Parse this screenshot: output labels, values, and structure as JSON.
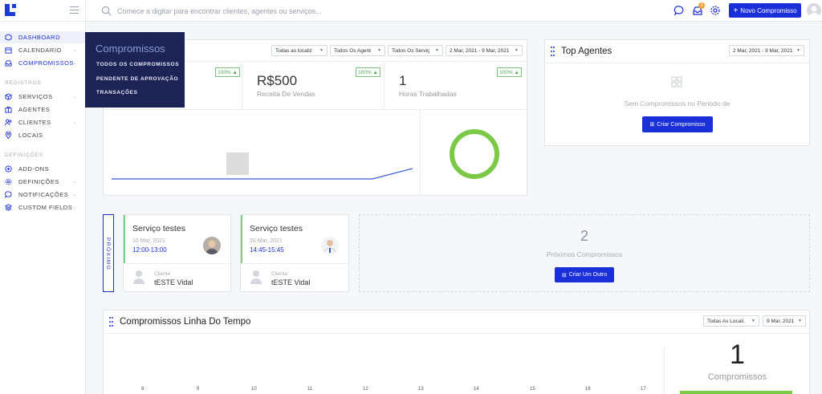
{
  "header": {
    "search_placeholder": "Comece a digitar para encontrar clientes, agentes ou serviços...",
    "notification_count": "1",
    "new_button_label": "Novo Compromisso",
    "new_button_icon": "plus-icon"
  },
  "sidebar": {
    "items": [
      {
        "label": "DASHBOARD",
        "icon": "dashboard-icon",
        "active": true
      },
      {
        "label": "CALENDARIO",
        "icon": "calendar-icon",
        "has_chevron": true
      },
      {
        "label": "COMPROMISSOS",
        "icon": "inbox-icon",
        "has_chevron": true
      }
    ],
    "section_registros": "REGISTROS",
    "registros": [
      {
        "label": "SERVIÇOS",
        "icon": "box-icon",
        "has_chevron": true
      },
      {
        "label": "AGENTES",
        "icon": "briefcase-icon"
      },
      {
        "label": "CLIENTES",
        "icon": "users-icon",
        "has_chevron": true
      },
      {
        "label": "LOCAIS",
        "icon": "map-pin-icon"
      }
    ],
    "section_definicoes": "DEFINIÇÕES",
    "definicoes": [
      {
        "label": "ADD-ONS",
        "icon": "plus-circle-icon"
      },
      {
        "label": "DEFINIÇÕES",
        "icon": "gear-icon",
        "has_chevron": true
      },
      {
        "label": "NOTIFICAÇÕES",
        "icon": "chat-icon",
        "has_chevron": true
      },
      {
        "label": "CUSTOM FIELDS",
        "icon": "layers-icon",
        "has_chevron": true
      }
    ]
  },
  "submenu": {
    "title": "Compromissos",
    "items": [
      "TODOS OS COMPROMISSOS",
      "PENDENTE DE APROVAÇÃO",
      "TRANSAÇÕES"
    ]
  },
  "stats_card": {
    "filters": [
      "Todas as localiz",
      "Todos Os Agent",
      "Todos Os Serviç",
      "2 Mar, 2021 - 9 Mar, 2021"
    ],
    "stats": [
      {
        "pct": "100% ▲"
      },
      {
        "value": "R$500",
        "label": "Receita De Vendas",
        "pct": "100% ▲"
      },
      {
        "value": "1",
        "label": "Horas Trabalhadas",
        "pct": "100% ▲"
      }
    ],
    "accent_color": "#7bc947"
  },
  "top_agents": {
    "title": "Top Agentes",
    "date_filter": "2 Mar, 2021 - 9 Mar, 2021",
    "empty_text": "Sem Compromissos no Periodo de",
    "button_label": "Criar Compromisso"
  },
  "proximo_label": "PRÓXIMO",
  "appointments": [
    {
      "title": "Serviço testes",
      "date": "10 Mar, 2021",
      "time": "12:00-13:00",
      "client_label": "Cliente",
      "client_name": "tESTE Vidal"
    },
    {
      "title": "Serviço testes",
      "date": "20 Mar, 2021",
      "time": "14:45-15:45",
      "client_label": "Cliente",
      "client_name": "tESTE Vidal"
    }
  ],
  "next_box": {
    "count": "2",
    "label": "Próximos Compromissos",
    "button_label": "Criar Um Outro"
  },
  "timeline": {
    "title": "Compromissos Linha Do Tempo",
    "location_filter": "Todas As Locali.",
    "date_filter": "9 Mar, 2021",
    "ticks": [
      "8",
      "9",
      "10",
      "11",
      "12",
      "13",
      "14",
      "15",
      "16",
      "17"
    ],
    "count": "1",
    "count_label": "Compromissos"
  },
  "colors": {
    "brand": "#1b2fd8",
    "sidebar_dark": "#1c2355",
    "success": "#7bc947"
  }
}
